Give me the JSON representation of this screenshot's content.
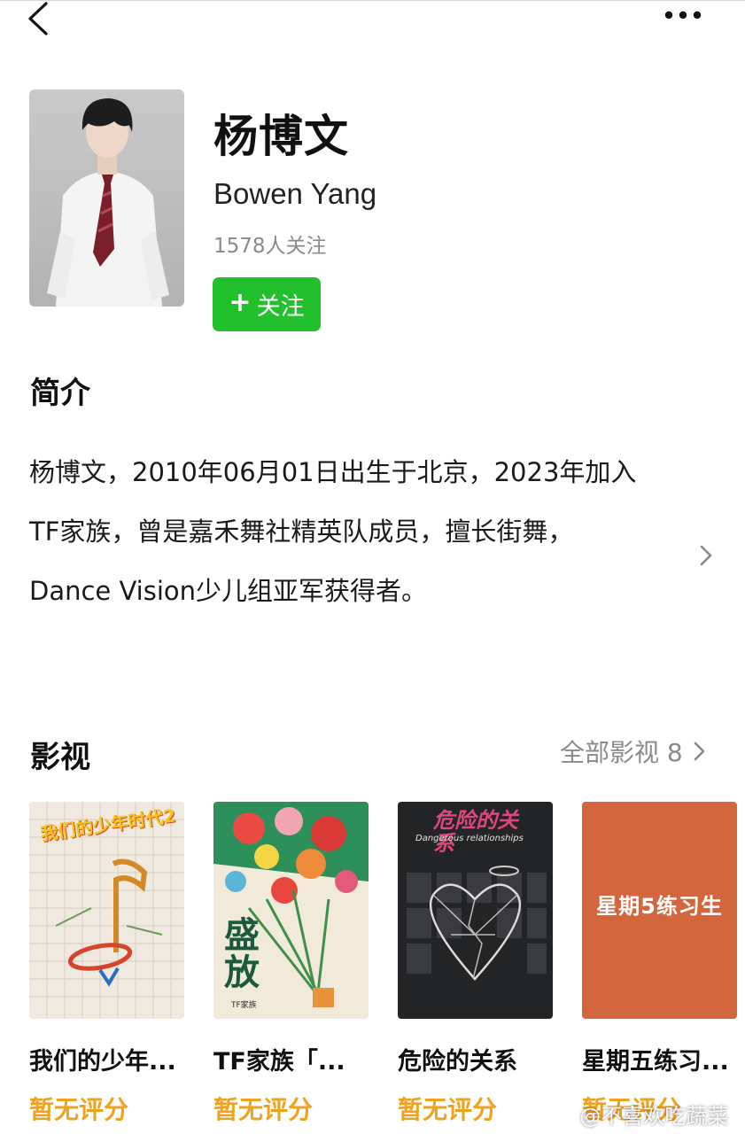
{
  "header": {
    "back_icon": "back-chevron-icon",
    "more_icon": "more-dots-icon"
  },
  "profile": {
    "name_cn": "杨博文",
    "name_en": "Bowen Yang",
    "followers": "1578人关注",
    "follow_plus": "+",
    "follow_label": "关注",
    "follow_color": "#22c02d"
  },
  "intro": {
    "title": "简介",
    "text": "杨博文，2010年06月01日出生于北京，2023年加入TF家族，曾是嘉禾舞社精英队成员，擅长街舞，Dance Vision少儿组亚军获得者。"
  },
  "works": {
    "title": "影视",
    "all_label": "全部影视 8",
    "items": [
      {
        "title": "我们的少年...",
        "rating": "暂无评分",
        "poster_text": "我们的少年时代2"
      },
      {
        "title": "TF家族「...",
        "rating": "暂无评分",
        "poster_text": "盛放",
        "poster_sub": "TF家族"
      },
      {
        "title": "危险的关系",
        "rating": "暂无评分",
        "poster_text": "危险的关系",
        "poster_sub": "Dangerous relationships"
      },
      {
        "title": "星期五练习...",
        "rating": "暂无评分",
        "poster_text": "星期5练习生"
      }
    ],
    "rating_color": "#f2a11c"
  },
  "watermark": "@不喜欢吃蔬菜菜"
}
